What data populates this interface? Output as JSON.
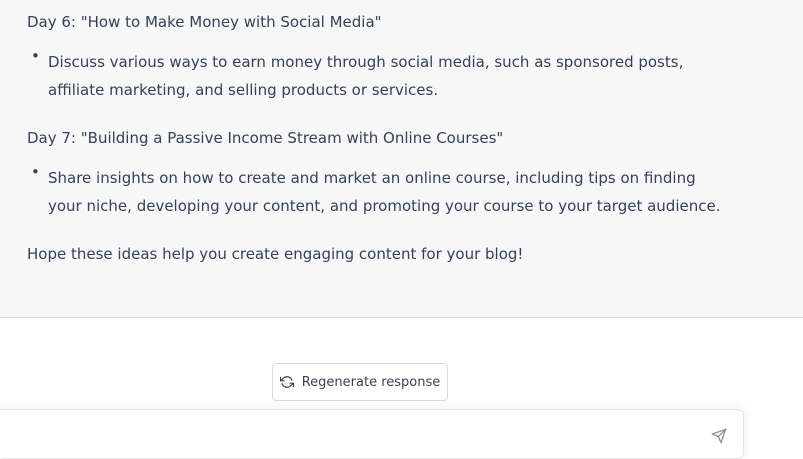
{
  "response": {
    "day6": {
      "heading": "Day 6: \"How to Make Money with Social Media\"",
      "bullet_line1": "Discuss various ways to earn money through social media, such as sponsored posts,",
      "bullet_line2": "affiliate marketing, and selling products or services."
    },
    "day7": {
      "heading": "Day 7: \"Building a Passive Income Stream with Online Courses\"",
      "bullet_line1": "Share insights on how to create and market an online course, including tips on finding",
      "bullet_line2": "your niche, developing your content, and promoting your course to your target audience."
    },
    "closing": "Hope these ideas help you create engaging content for your blog!",
    "bullet_glyph": "•"
  },
  "controls": {
    "regenerate_label": "Regenerate response",
    "regenerate_icon": "refresh-icon",
    "send_icon": "paper-plane-icon"
  },
  "colors": {
    "response_bg": "#f7f7f8",
    "text": "#374151",
    "border": "#d9d9e3"
  }
}
